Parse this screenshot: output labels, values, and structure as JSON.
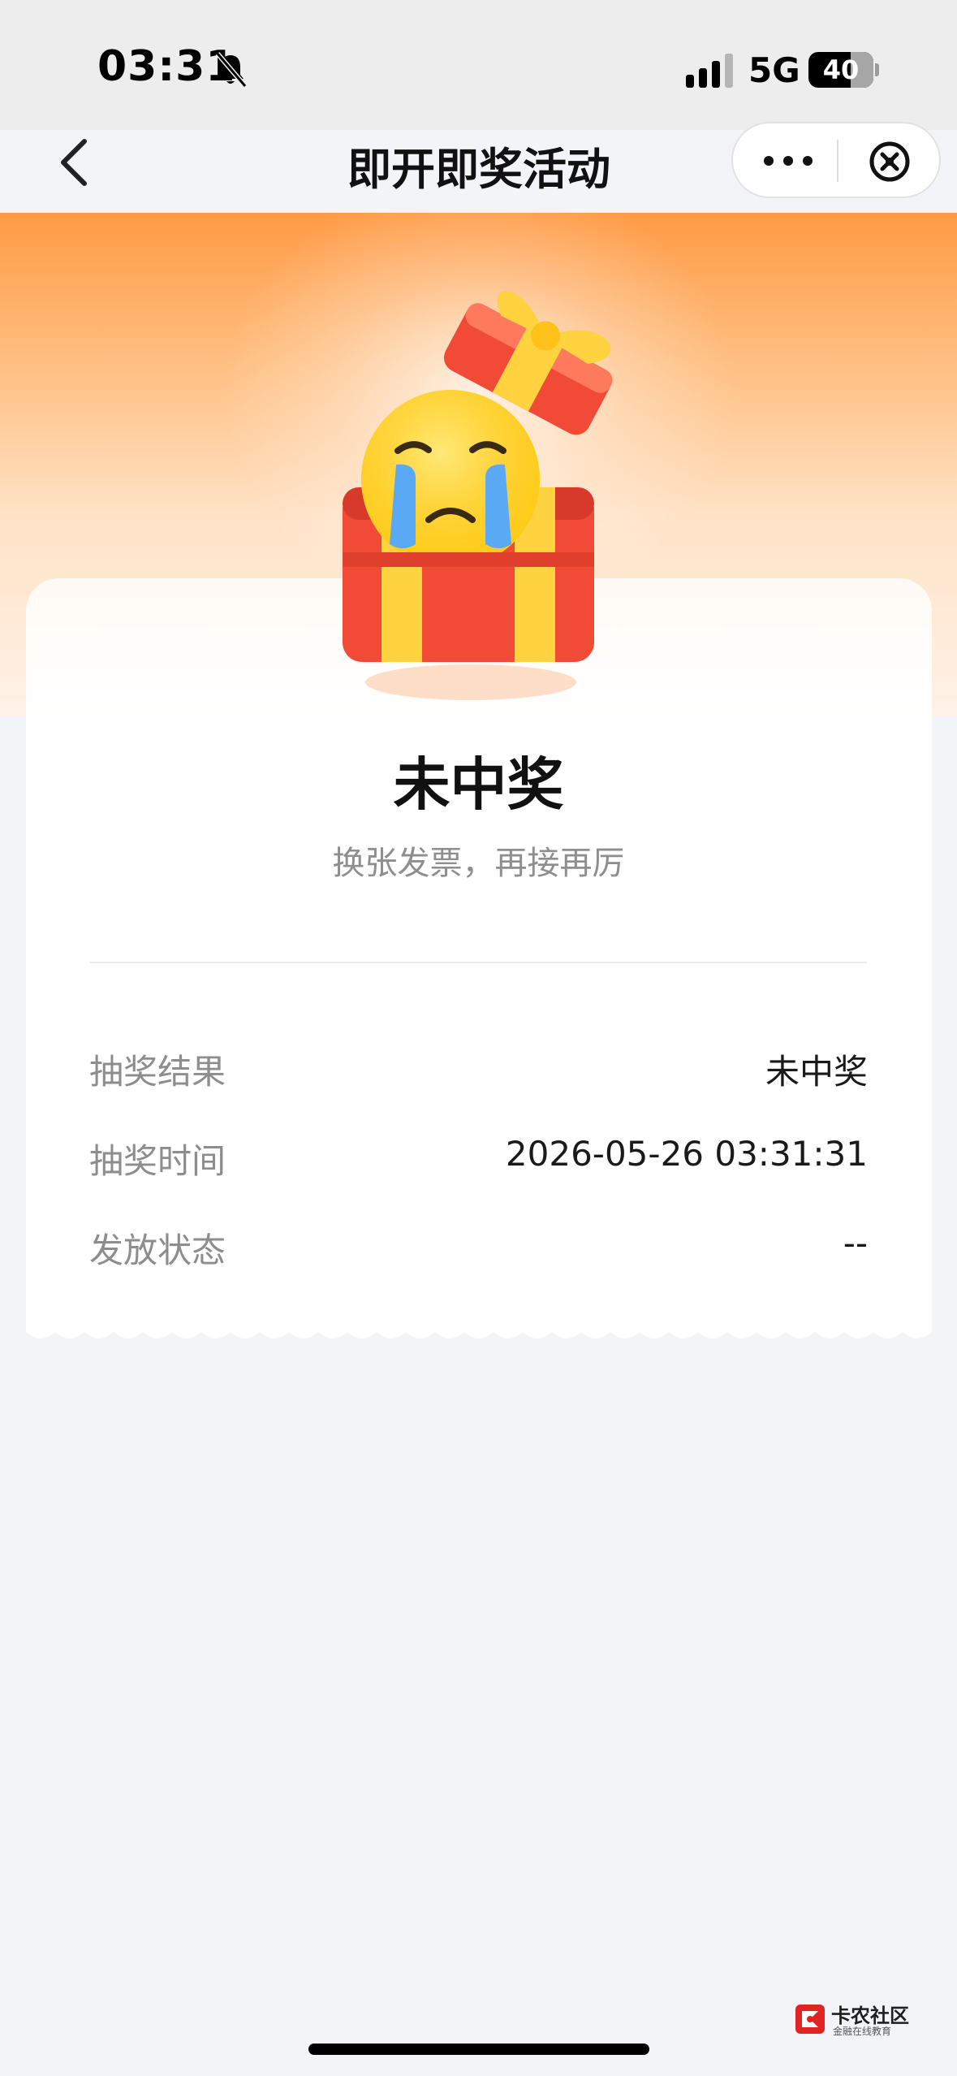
{
  "status_bar": {
    "time": "03:31",
    "network": "5G",
    "battery": "40"
  },
  "nav": {
    "title": "即开即奖活动"
  },
  "result": {
    "title": "未中奖",
    "subtitle": "换张发票，再接再厉"
  },
  "details": [
    {
      "label": "抽奖结果",
      "value": "未中奖"
    },
    {
      "label": "抽奖时间",
      "value": "2026-05-26 03:31:31"
    },
    {
      "label": "发放状态",
      "value": "--"
    }
  ],
  "watermark": {
    "name": "卡农社区",
    "tagline": "金融在线教育"
  },
  "colors": {
    "banner_top": "#ff9a45",
    "page_bg": "#f3f4f8",
    "card_bg": "#ffffff",
    "gift_red": "#f04a3a",
    "ribbon_yellow": "#ffd23f"
  }
}
